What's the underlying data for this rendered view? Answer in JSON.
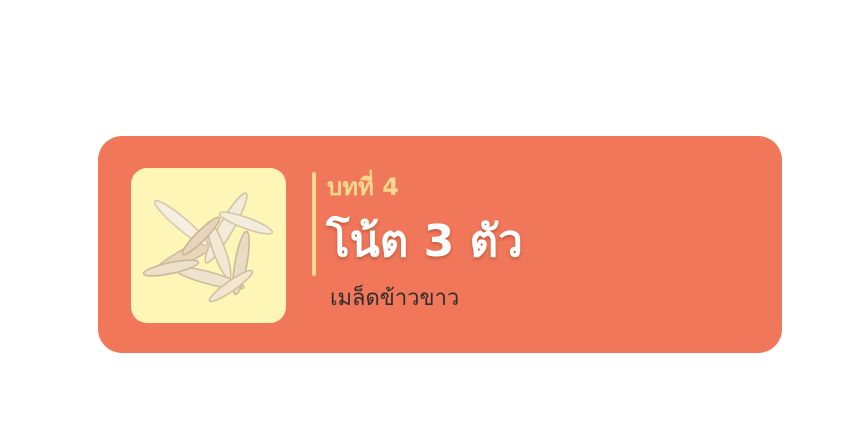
{
  "lesson_card": {
    "lesson_number": "บทที่ 4",
    "title": "โน้ต 3 ตัว",
    "subtitle": "เมล็ดข้าวขาว",
    "thumbnail": {
      "icon": "rice-grains-icon",
      "background_color": "#fdf6b6"
    }
  },
  "colors": {
    "card_background": "#f07759",
    "accent": "#f8d98e",
    "title": "#ffffff",
    "subtitle": "#2e2e2e"
  }
}
